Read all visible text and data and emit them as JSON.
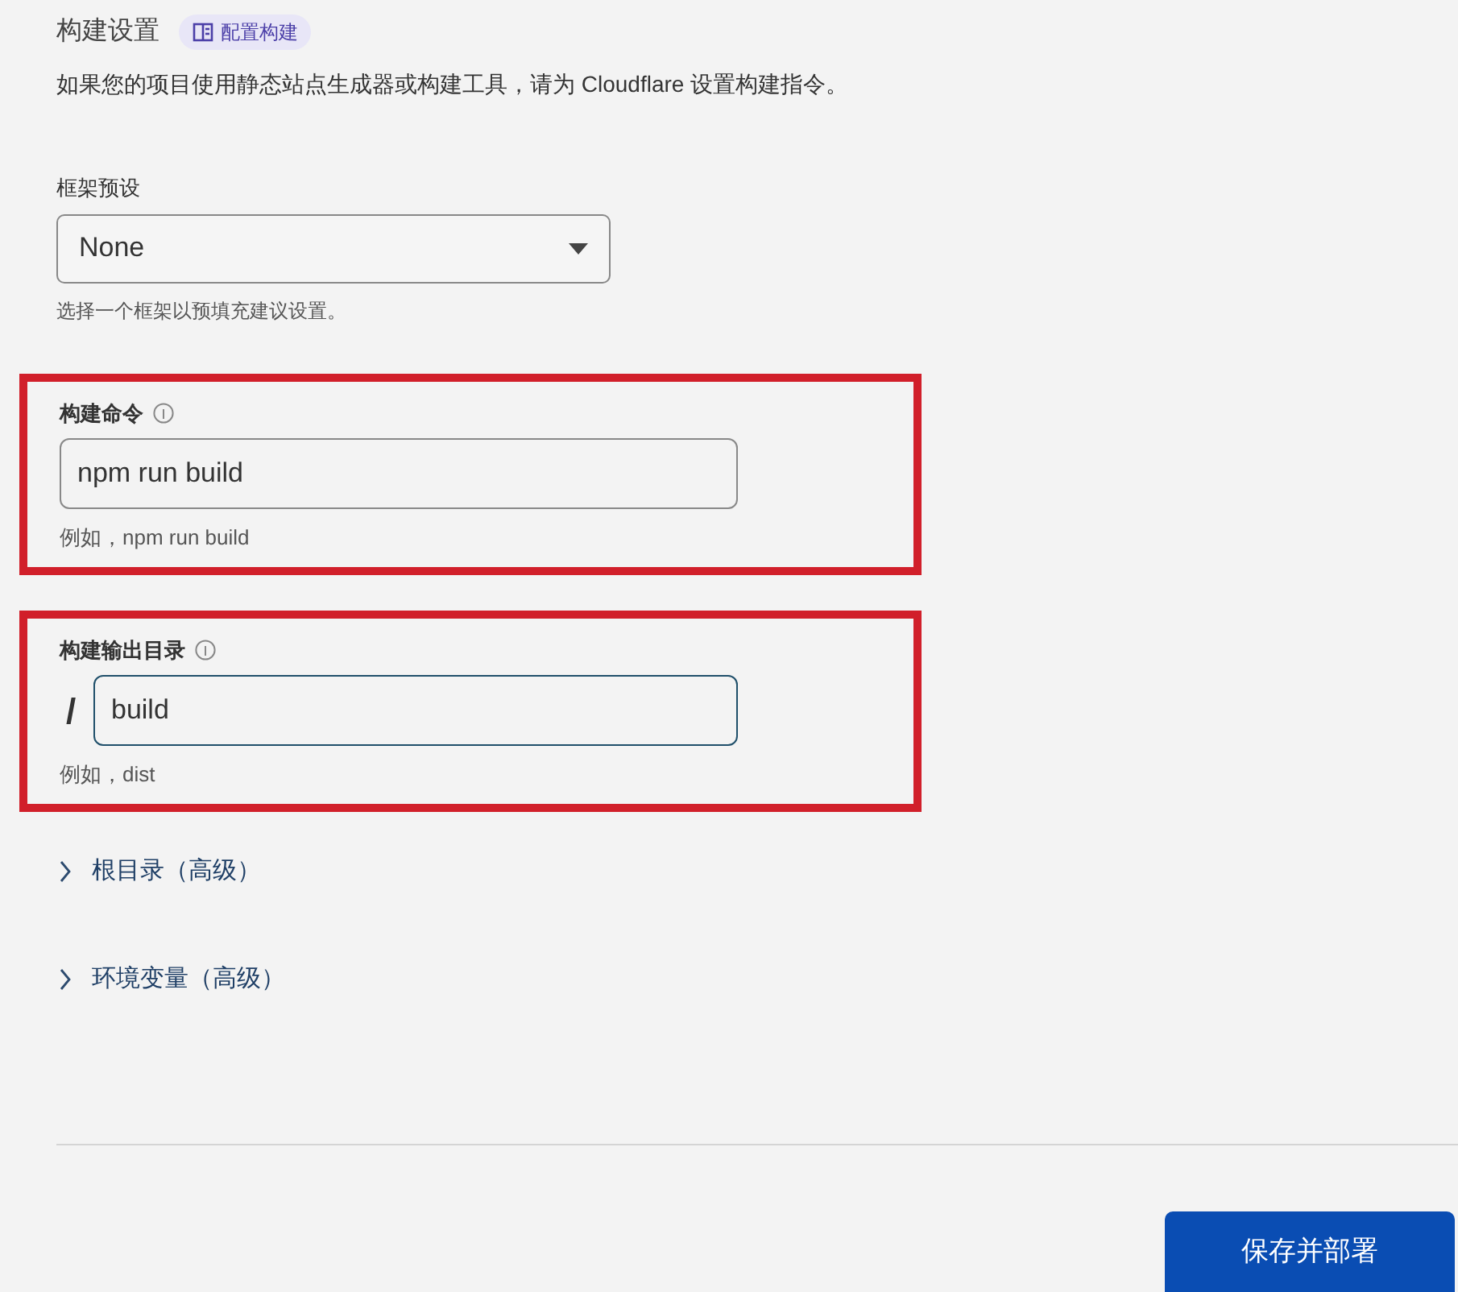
{
  "section": {
    "title": "构建设置",
    "doc_link": "配置构建",
    "description": "如果您的项目使用静态站点生成器或构建工具，请为 Cloudflare 设置构建指令。"
  },
  "framework_preset": {
    "label": "框架预设",
    "value": "None",
    "hint": "选择一个框架以预填充建议设置。"
  },
  "fields": [
    {
      "label": "构建命令",
      "value": "npm run build",
      "hint": "例如，npm run build",
      "focused": false,
      "highlighted": true
    },
    {
      "label": "构建输出目录",
      "prefix": "/",
      "value": "build",
      "hint": "例如，dist",
      "focused": true,
      "highlighted": true
    }
  ],
  "expanders": [
    {
      "label": "根目录（高级）",
      "expanded": false
    },
    {
      "label": "环境变量（高级）",
      "expanded": false
    }
  ],
  "save_button": "保存并部署"
}
